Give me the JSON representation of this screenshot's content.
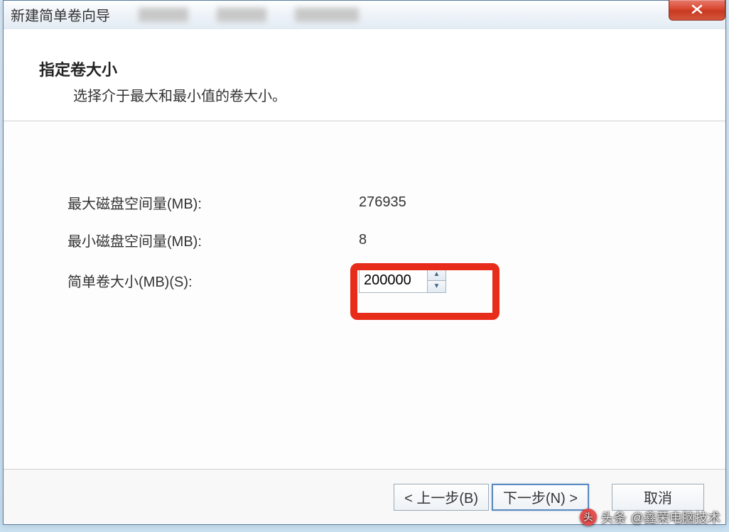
{
  "window": {
    "title": "新建简单卷向导"
  },
  "header": {
    "title": "指定卷大小",
    "subtitle": "选择介于最大和最小值的卷大小。"
  },
  "fields": {
    "max_space": {
      "label": "最大磁盘空间量(MB):",
      "value": "276935"
    },
    "min_space": {
      "label": "最小磁盘空间量(MB):",
      "value": "8"
    },
    "volume_size": {
      "label": "简单卷大小(MB)(S):",
      "value": "200000"
    }
  },
  "buttons": {
    "back": "< 上一步(B)",
    "next": "下一步(N) >",
    "cancel": "取消"
  },
  "watermark": {
    "prefix": "头条",
    "author": "@鑫荣电脑技术"
  }
}
